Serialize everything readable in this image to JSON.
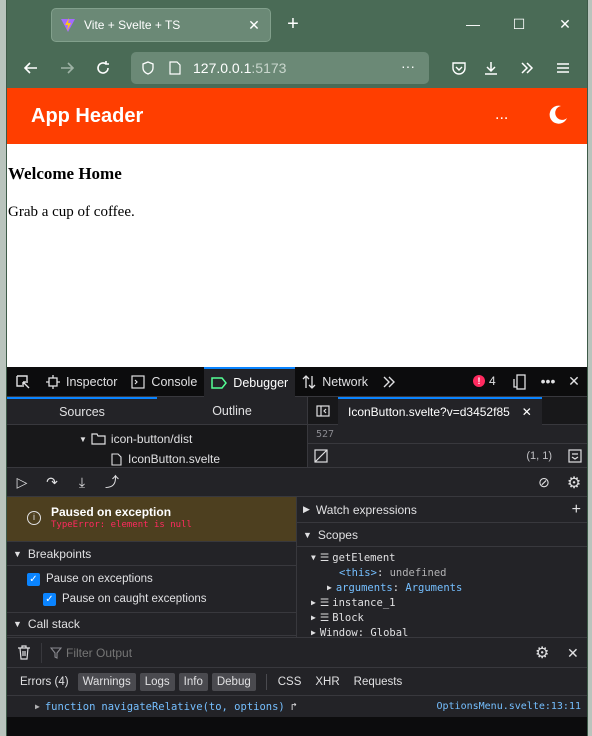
{
  "browser": {
    "tab_title": "Vite + Svelte + TS",
    "tab_close": "✕",
    "new_tab": "+",
    "window_controls": {
      "minimize": "—",
      "maximize": "☐",
      "close": "✕"
    },
    "url_host": "127.0.0.1",
    "url_port": ":5173",
    "url_more": "···"
  },
  "app": {
    "header_title": "App Header",
    "menu_dots": "...",
    "heading": "Welcome Home",
    "body_text": "Grab a cup of coffee."
  },
  "devtools": {
    "tabs": {
      "inspector": "Inspector",
      "console": "Console",
      "debugger": "Debugger",
      "network": "Network"
    },
    "error_count": "4",
    "sources": {
      "subtabs": {
        "sources": "Sources",
        "outline": "Outline"
      },
      "tree": {
        "folder": "icon-button/dist",
        "file": "IconButton.svelte"
      }
    },
    "editor": {
      "tab_label": "IconButton.svelte?v=d3452f85",
      "line_number": "527",
      "cursor_pos": "(1, 1)"
    },
    "paused": {
      "title": "Paused on exception",
      "message": "TypeError: element is null"
    },
    "breakpoints": {
      "header": "Breakpoints",
      "pause_on_exceptions": "Pause on exceptions",
      "pause_on_caught": "Pause on caught exceptions"
    },
    "call_stack": {
      "header": "Call stack"
    },
    "watch": {
      "header": "Watch expressions"
    },
    "scopes": {
      "header": "Scopes",
      "get_element": "getElement",
      "this_key": "<this>",
      "this_val": "undefined",
      "args_key": "arguments",
      "args_val": "Arguments",
      "instance": "instance_1",
      "block": "Block",
      "window_key": "Window",
      "window_val": "Global"
    },
    "console": {
      "filter_placeholder": "Filter Output",
      "filters": {
        "errors": "Errors (4)",
        "warnings": "Warnings",
        "logs": "Logs",
        "info": "Info",
        "debug": "Debug",
        "css": "CSS",
        "xhr": "XHR",
        "requests": "Requests"
      },
      "message_keyword": "function",
      "message_fn": "navigateRelative",
      "message_params": "(to, options)",
      "message_source": "OptionsMenu.svelte:13:11"
    }
  },
  "colors": {
    "accent": "#0a84ff",
    "app_header": "#ff3e00",
    "browser_chrome": "#4a6b56",
    "error": "#ff2a5f"
  }
}
